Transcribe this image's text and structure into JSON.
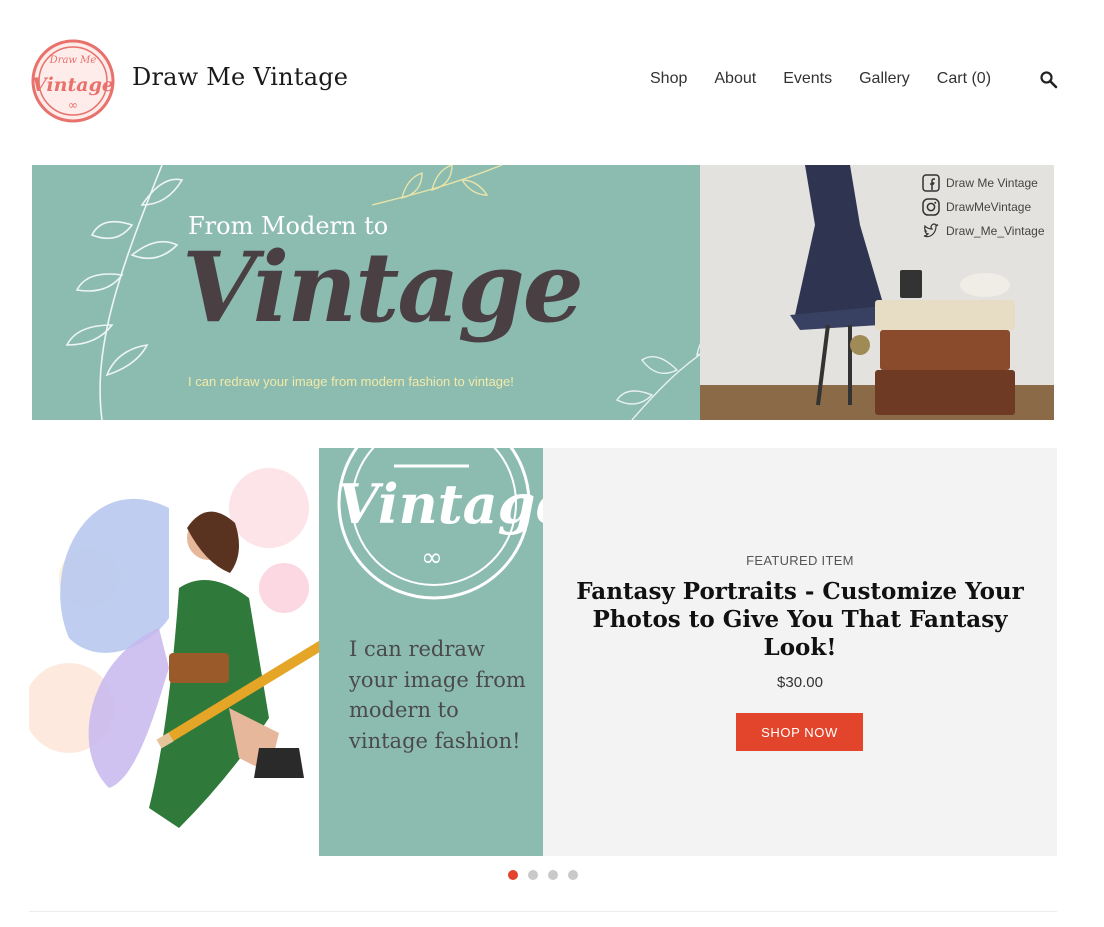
{
  "site": {
    "title": "Draw Me Vintage",
    "logo_text_top": "Draw Me",
    "logo_text_main": "Vintage"
  },
  "nav": {
    "items": [
      {
        "label": "Shop"
      },
      {
        "label": "About"
      },
      {
        "label": "Events"
      },
      {
        "label": "Gallery"
      },
      {
        "label": "Cart (0)"
      }
    ],
    "search_icon": "search-icon"
  },
  "banner": {
    "subtitle": "From Modern to",
    "headline": "Vintage",
    "caption": "I can redraw your image from modern fashion to vintage!",
    "socials": [
      {
        "icon": "facebook-icon",
        "label": "Draw Me Vintage"
      },
      {
        "icon": "instagram-icon",
        "label": "DrawMeVintage"
      },
      {
        "icon": "twitter-icon",
        "label": "Draw_Me_Vintage"
      }
    ]
  },
  "featured": {
    "image_logo": "Vintage",
    "image_text": "I can redraw your image from modern to vintage fashion!",
    "label": "FEATURED ITEM",
    "title": "Fantasy Portraits - Customize Your Photos to Give You That Fantasy Look!",
    "price": "$30.00",
    "button": "SHOP NOW"
  },
  "slider": {
    "total": 4,
    "active_index": 1
  },
  "colors": {
    "accent": "#e2452b",
    "sage": "#8cbcb0",
    "logo_pink": "#e8716c"
  }
}
